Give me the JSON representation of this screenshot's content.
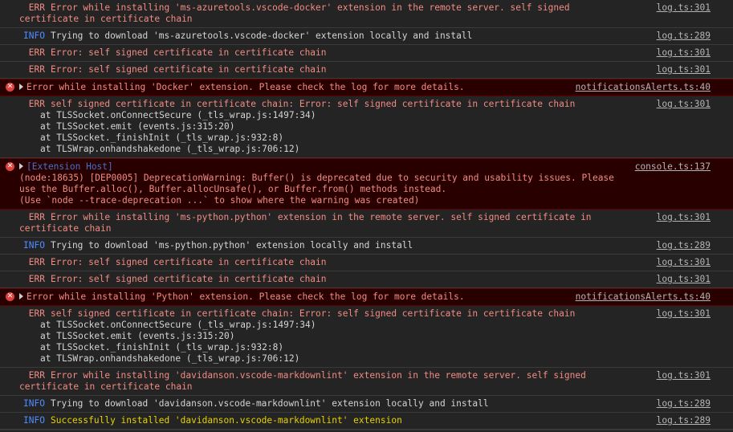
{
  "console": {
    "rows": [
      {
        "level": "ERR",
        "message": "Error while installing 'ms-azuretools.vscode-docker' extension in the remote server. self signed certificate in certificate chain",
        "source": "log.ts:301"
      },
      {
        "level": "INFO",
        "message": "Trying to download 'ms-azuretools.vscode-docker' extension locally and install",
        "source": "log.ts:289"
      },
      {
        "level": "ERR",
        "message": "Error: self signed certificate in certificate chain",
        "source": "log.ts:301"
      },
      {
        "level": "ERR",
        "message": "Error: self signed certificate in certificate chain",
        "source": "log.ts:301"
      }
    ],
    "docker_alert": {
      "message": "Error while installing 'Docker' extension. Please check the log for more details.",
      "source": "notificationsAlerts.ts:40"
    },
    "docker_stack": {
      "level": "ERR",
      "first_line": "self signed certificate in certificate chain: Error: self signed certificate in certificate chain",
      "lines": [
        "at TLSSocket.onConnectSecure (_tls_wrap.js:1497:34)",
        "at TLSSocket.emit (events.js:315:20)",
        "at TLSSocket._finishInit (_tls_wrap.js:932:8)",
        "at TLSWrap.onhandshakedone (_tls_wrap.js:706:12)"
      ],
      "source": "log.ts:301"
    },
    "deprecation": {
      "tag": "[Extension Host]",
      "lines": [
        "(node:18635) [DEP0005] DeprecationWarning: Buffer() is deprecated due to security and usability issues. Please use the Buffer.alloc(), Buffer.allocUnsafe(), or Buffer.from() methods instead.",
        "(Use `node --trace-deprecation ...` to show where the warning was created)"
      ],
      "source": "console.ts:137"
    },
    "python_rows": [
      {
        "level": "ERR",
        "message": "Error while installing 'ms-python.python' extension in the remote server. self signed certificate in certificate chain",
        "source": "log.ts:301"
      },
      {
        "level": "INFO",
        "message": "Trying to download 'ms-python.python' extension locally and install",
        "source": "log.ts:289"
      },
      {
        "level": "ERR",
        "message": "Error: self signed certificate in certificate chain",
        "source": "log.ts:301"
      },
      {
        "level": "ERR",
        "message": "Error: self signed certificate in certificate chain",
        "source": "log.ts:301"
      }
    ],
    "python_alert": {
      "message": "Error while installing 'Python' extension. Please check the log for more details.",
      "source": "notificationsAlerts.ts:40"
    },
    "python_stack": {
      "level": "ERR",
      "first_line": "self signed certificate in certificate chain: Error: self signed certificate in certificate chain",
      "lines": [
        "at TLSSocket.onConnectSecure (_tls_wrap.js:1497:34)",
        "at TLSSocket.emit (events.js:315:20)",
        "at TLSSocket._finishInit (_tls_wrap.js:932:8)",
        "at TLSWrap.onhandshakedone (_tls_wrap.js:706:12)"
      ],
      "source": "log.ts:301"
    },
    "markdown_rows": [
      {
        "level": "ERR",
        "message": "Error while installing 'davidanson.vscode-markdownlint' extension in the remote server. self signed certificate in certificate chain",
        "source": "log.ts:301"
      },
      {
        "level": "INFO",
        "message": "Trying to download 'davidanson.vscode-markdownlint' extension locally and install",
        "source": "log.ts:289"
      },
      {
        "level": "INFO",
        "message": "Successfully installed 'davidanson.vscode-markdownlint' extension",
        "source": "log.ts:289"
      }
    ],
    "prompt": {
      "icon": "chevron-right-icon",
      "glyph": "›",
      "value": ""
    },
    "colors": {
      "background": "#242424",
      "error_row_bg": "#290000",
      "err_text": "#f28b82",
      "info_level": "#4e8cff",
      "success_text": "#e5d200",
      "error_icon": "#e0423c"
    }
  }
}
